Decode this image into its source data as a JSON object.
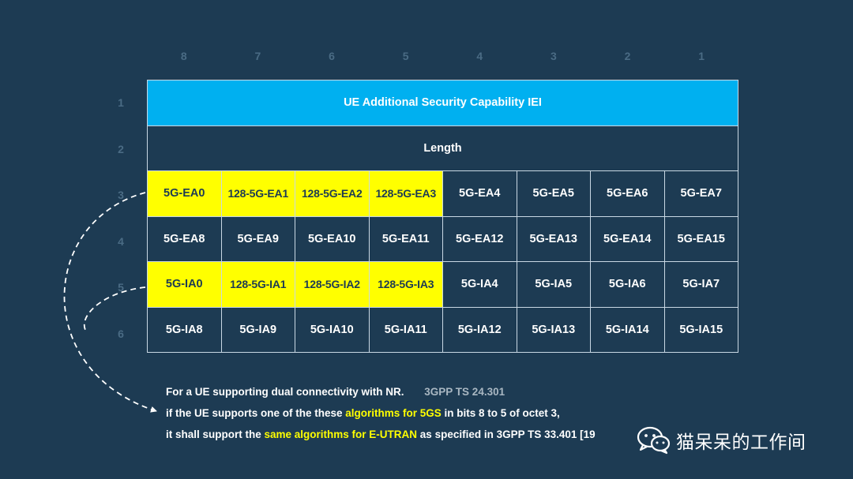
{
  "bit_numbers": [
    "8",
    "7",
    "6",
    "5",
    "4",
    "3",
    "2",
    "1"
  ],
  "octet_numbers": [
    "1",
    "2",
    "3",
    "4",
    "5",
    "6"
  ],
  "table": {
    "title": "UE Additional Security Capability IEI",
    "length": "Length",
    "octet3": [
      "5G-EA0",
      "128-5G-EA1",
      "128-5G-EA2",
      "128-5G-EA3",
      "5G-EA4",
      "5G-EA5",
      "5G-EA6",
      "5G-EA7"
    ],
    "octet4": [
      "5G-EA8",
      "5G-EA9",
      "5G-EA10",
      "5G-EA11",
      "5G-EA12",
      "5G-EA13",
      "5G-EA14",
      "5G-EA15"
    ],
    "octet5": [
      "5G-IA0",
      "128-5G-IA1",
      "128-5G-IA2",
      "128-5G-IA3",
      "5G-IA4",
      "5G-IA5",
      "5G-IA6",
      "5G-IA7"
    ],
    "octet6": [
      "5G-IA8",
      "5G-IA9",
      "5G-IA10",
      "5G-IA11",
      "5G-IA12",
      "5G-IA13",
      "5G-IA14",
      "5G-IA15"
    ]
  },
  "notes": {
    "line1": "For a UE supporting dual connectivity with NR.",
    "ref": "3GPP TS 24.301",
    "line2_a": "if the UE supports one of the these ",
    "line2_hl": "algorithms for 5GS",
    "line2_b": " in bits 8 to 5 of octet 3,",
    "line3_a": "it shall support the ",
    "line3_hl": "same algorithms for E-UTRAN",
    "line3_b": " as specified in 3GPP TS 33.401 [19"
  },
  "watermark": {
    "text": "猫呆呆的工作间",
    "icon": "wechat-icon"
  },
  "colors": {
    "background": "#1d3b53",
    "title_cell": "#00b0f0",
    "highlight": "#ffff00",
    "muted_text": "#4a6b84"
  }
}
